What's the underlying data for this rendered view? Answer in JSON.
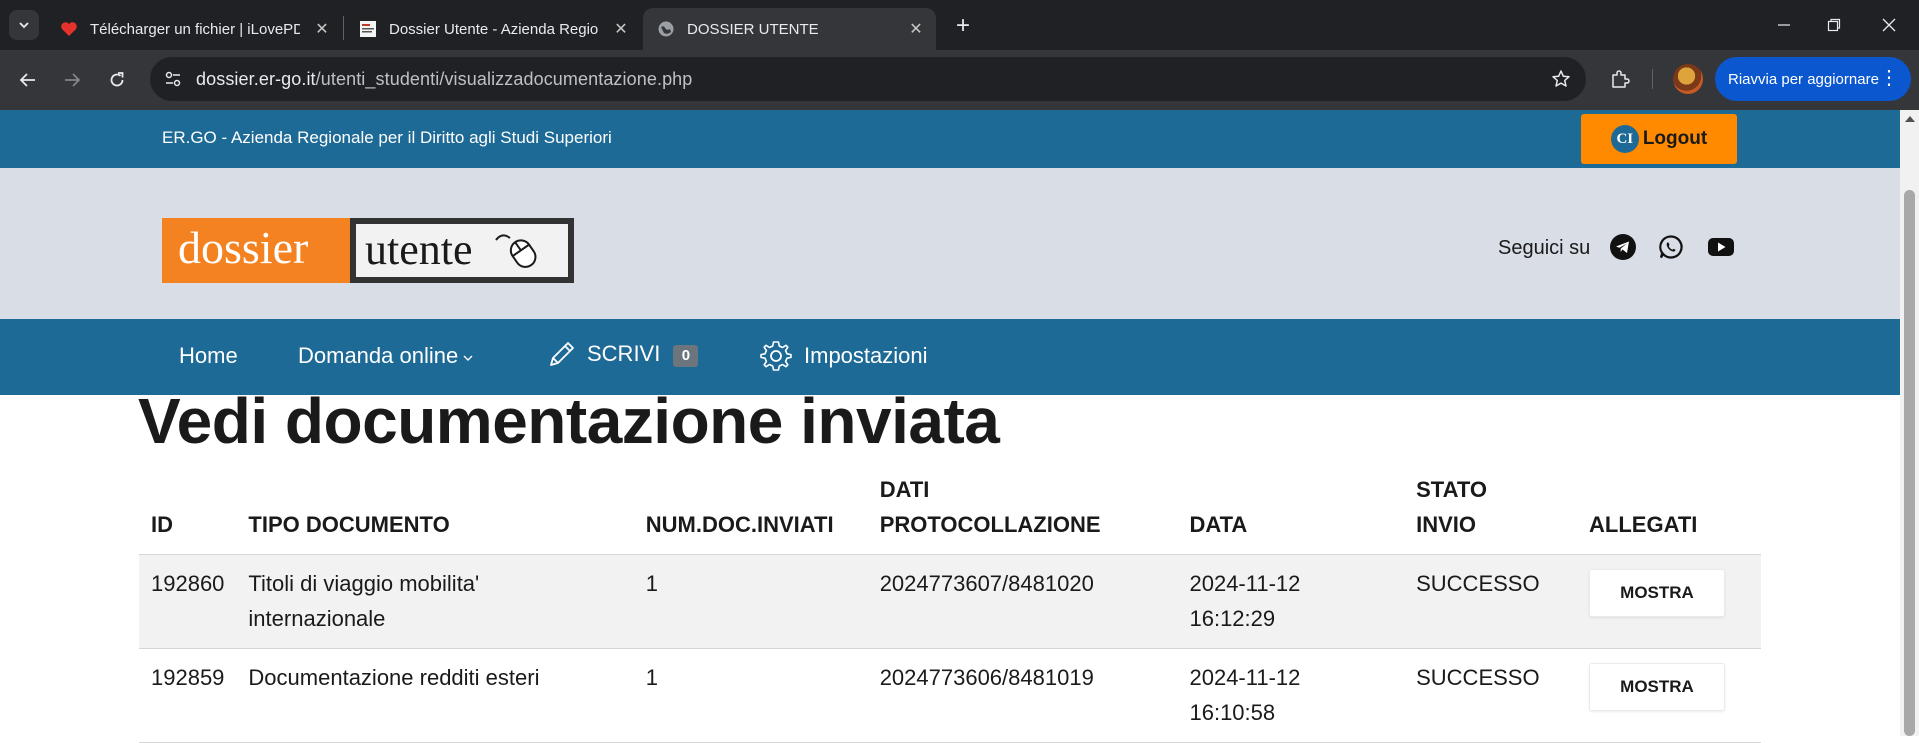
{
  "browser": {
    "tabs": [
      {
        "title": "Télécharger un fichier | iLovePDF",
        "favicon": "heart-icon",
        "active": false
      },
      {
        "title": "Dossier Utente - Azienda Regionale",
        "favicon": "document-favicon-icon",
        "active": false
      },
      {
        "title": "DOSSIER UTENTE",
        "favicon": "globe-icon",
        "active": true
      }
    ],
    "url_host": "dossier.er-go.it",
    "url_path": "/utenti_studenti/visualizzadocumentazione.php",
    "update_button": "Riavvia per aggiornare",
    "accent_color": "#0b57d0"
  },
  "site": {
    "org_name": "ER.GO - Azienda Regionale per il Diritto agli Studi Superiori",
    "logout_icon_text": "CI",
    "logout_label": "Logout",
    "logo_left": "dossier",
    "logo_right": "utente",
    "social_label": "Seguici su",
    "social_icons": [
      "telegram-icon",
      "whatsapp-icon",
      "youtube-icon"
    ],
    "colors": {
      "primary": "#1d6a96",
      "orange": "#ff8a00",
      "header_bg": "#d9dde5"
    }
  },
  "nav": {
    "home": "Home",
    "domanda": "Domanda online",
    "scrivi": "SCRIVI",
    "scrivi_count": "0",
    "impostazioni": "Impostazioni"
  },
  "page": {
    "title": "Vedi documentazione inviata"
  },
  "table": {
    "headers": {
      "id": "ID",
      "tipo": "TIPO DOCUMENTO",
      "num": "NUM.DOC.INVIATI",
      "dati_line1": "DATI",
      "dati_line2": "PROTOCOLLAZIONE",
      "data": "DATA",
      "stato_line1": "STATO",
      "stato_line2": "INVIO",
      "allegati": "ALLEGATI"
    },
    "rows": [
      {
        "id": "192860",
        "tipo": "Titoli di viaggio mobilita' internazionale",
        "num": "1",
        "protocollo": "2024773607/8481020",
        "date": "2024-11-12",
        "time": "16:12:29",
        "stato": "SUCCESSO",
        "action": "MOSTRA"
      },
      {
        "id": "192859",
        "tipo": "Documentazione redditi esteri",
        "num": "1",
        "protocollo": "2024773606/8481019",
        "date": "2024-11-12",
        "time": "16:10:58",
        "stato": "SUCCESSO",
        "action": "MOSTRA"
      }
    ]
  }
}
